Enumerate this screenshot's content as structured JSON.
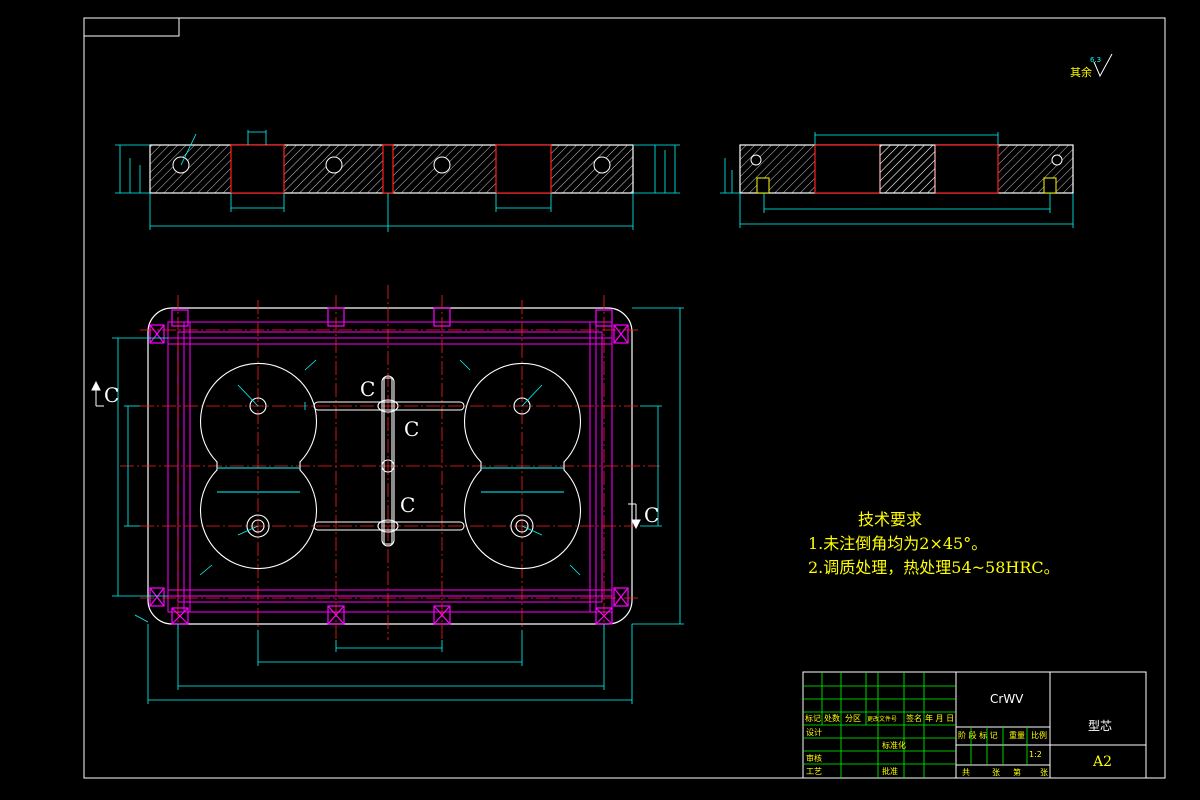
{
  "drawing": {
    "surface_finish": "其余",
    "surface_value": "6.3",
    "section_labels": [
      "C",
      "C",
      "C",
      "C",
      "C"
    ],
    "colors": {
      "background": "#000000",
      "outline": "#ffffff",
      "dimension": "#00ffff",
      "centerline": "#ff0000",
      "magenta": "#ff00ff",
      "hatch": "#ffffff",
      "text": "#ffff00",
      "green": "#00ff00"
    }
  },
  "tech_requirements": {
    "title": "技术要求",
    "items": [
      "1.未注倒角均为2×45°。",
      "2.调质处理，热处理54~58HRC。"
    ]
  },
  "title_block": {
    "material": "CrWV",
    "part_name": "型芯",
    "sheet_size": "A2",
    "scale": "1:2",
    "headers": [
      "标记",
      "处数",
      "分区",
      "更改文件号",
      "签名",
      "年 月 日"
    ],
    "rows": [
      "设计",
      "审核",
      "工艺"
    ],
    "mid_labels": [
      "标准化",
      "批准"
    ],
    "stage_headers": [
      "阶 段 标 记",
      "重量",
      "比例"
    ],
    "footer": [
      "共",
      "张",
      "第",
      "张"
    ]
  }
}
